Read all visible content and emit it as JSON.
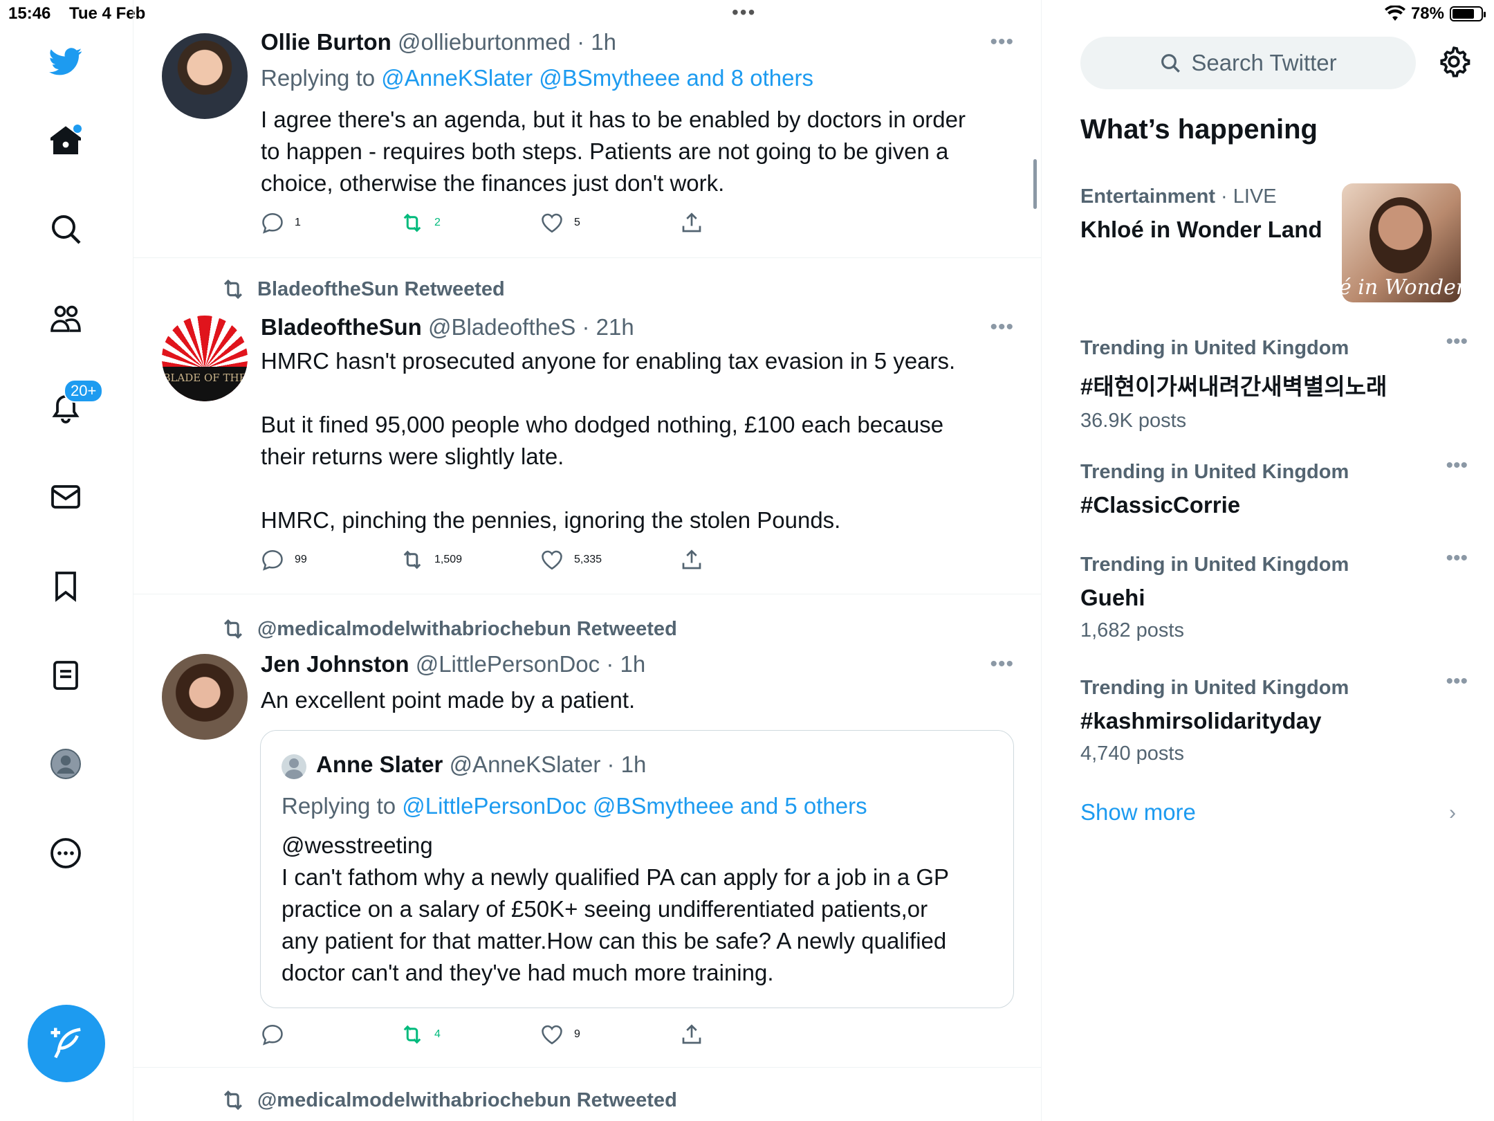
{
  "status": {
    "time": "15:46",
    "date": "Tue 4 Feb",
    "battery": "78%",
    "battery_level": 0.78
  },
  "nav": {
    "notifications_badge": "20+"
  },
  "tweets": [
    {
      "name": "Ollie Burton",
      "handle": "@ollieburtonmed · 1h",
      "replying_prefix": "Replying to ",
      "replying_links": "@AnneKSlater @BSmytheee and 8 others",
      "text": "I agree there's an agenda, but it has to be enabled by doctors in order\nto happen - requires both steps. Patients are not going to be given a\nchoice, otherwise the finances just don't work.",
      "replies": "1",
      "retweets": "2",
      "likes": "5"
    },
    {
      "retweeted_by": "BladeoftheSun Retweeted",
      "name": "BladeoftheSun",
      "handle": "@BladeoftheS · 21h",
      "text": "HMRC hasn't prosecuted anyone for enabling tax evasion in 5 years.\n\nBut it fined 95,000 people who dodged nothing, £100 each because\ntheir returns were slightly late.\n\nHMRC, pinching the pennies, ignoring the stolen Pounds.",
      "replies": "99",
      "retweets": "1,509",
      "likes": "5,335",
      "avatar_text": "BLADE OF THE"
    },
    {
      "retweeted_by": "@medicalmodelwithabriochebun Retweeted",
      "name": "Jen Johnston",
      "handle": "@LittlePersonDoc · 1h",
      "text": "An excellent point made by a patient.",
      "quote": {
        "name": "Anne Slater",
        "handle": "@AnneKSlater · 1h",
        "replying_prefix": "Replying to ",
        "replying_links": "@LittlePersonDoc @BSmytheee and 5 others",
        "text": "@wesstreeting\nI can't fathom why a newly qualified PA can apply for a job in a GP\npractice on a salary of £50K+ seeing undifferentiated patients,or\nany patient for that matter.How can this be safe? A newly qualified\ndoctor can't and they've had much more training."
      },
      "replies": "",
      "retweets": "4",
      "likes": "9"
    },
    {
      "retweeted_by": "@medicalmodelwithabriochebun Retweeted"
    }
  ],
  "right": {
    "search_placeholder": "Search Twitter",
    "heading": "What’s happening",
    "trends": [
      {
        "category": "Entertainment",
        "live": " · LIVE",
        "title": "Khloé in Wonder Land",
        "image_text": "é in Wonder L"
      },
      {
        "category": "Trending in United Kingdom",
        "title": "#태현이가써내려간새벽별의노래",
        "count": "36.9K posts"
      },
      {
        "category": "Trending in United Kingdom",
        "title": "#ClassicCorrie"
      },
      {
        "category": "Trending in United Kingdom",
        "title": "Guehi",
        "count": "1,682 posts"
      },
      {
        "category": "Trending in United Kingdom",
        "title": "#kashmirsolidarityday",
        "count": "4,740 posts"
      }
    ],
    "show_more": "Show more"
  }
}
